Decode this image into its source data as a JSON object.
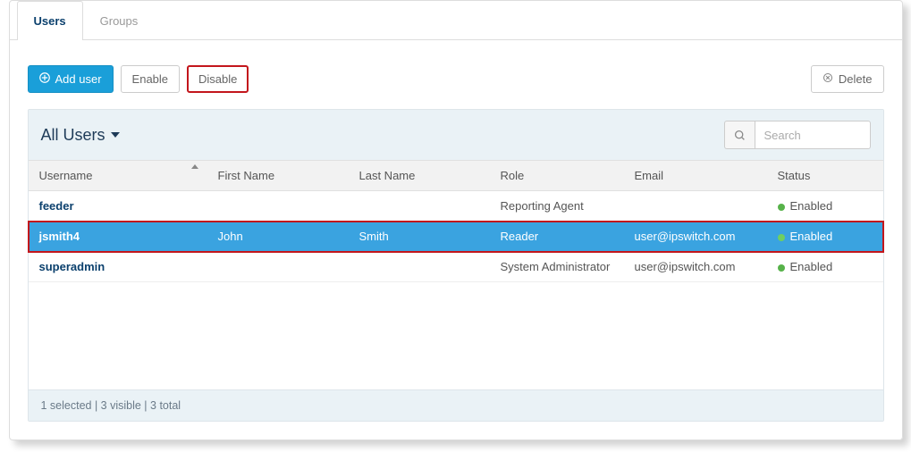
{
  "tabs": [
    "Users",
    "Groups"
  ],
  "activeTab": 0,
  "toolbar": {
    "addUser": "Add user",
    "enable": "Enable",
    "disable": "Disable",
    "delete": "Delete"
  },
  "panel": {
    "title": "All Users",
    "searchPlaceholder": "Search"
  },
  "columns": [
    "Username",
    "First Name",
    "Last Name",
    "Role",
    "Email",
    "Status"
  ],
  "sortedColumn": 0,
  "rows": [
    {
      "username": "feeder",
      "first": "",
      "last": "",
      "role": "Reporting Agent",
      "email": "",
      "status": "Enabled",
      "selected": false
    },
    {
      "username": "jsmith4",
      "first": "John",
      "last": "Smith",
      "role": "Reader",
      "email": "user@ipswitch.com",
      "status": "Enabled",
      "selected": true
    },
    {
      "username": "superadmin",
      "first": "",
      "last": "",
      "role": "System Administrator",
      "email": "user@ipswitch.com",
      "status": "Enabled",
      "selected": false
    }
  ],
  "footer": "1 selected | 3 visible | 3 total"
}
